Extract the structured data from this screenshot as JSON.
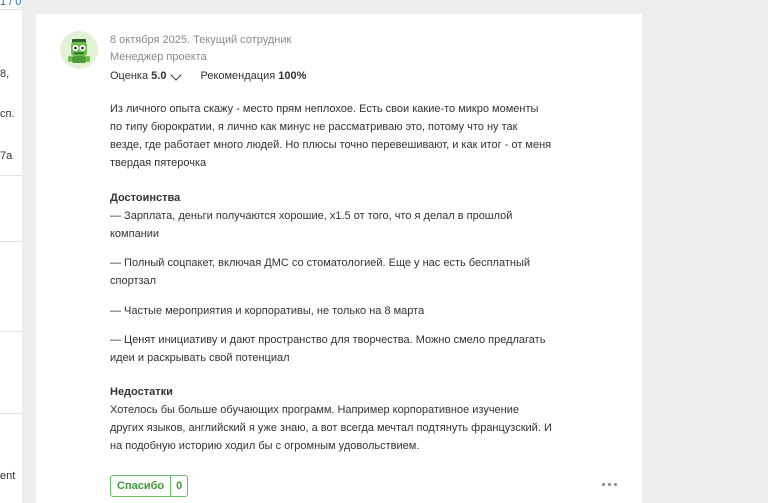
{
  "left_fragments": [
    "1 / 0",
    "8,",
    "сп.",
    "7а",
    "ent"
  ],
  "review": {
    "date_status": "8 октября 2025. Текущий сотрудник",
    "position": "Менеджер проекта",
    "rating_label": "Оценка",
    "rating_value": "5.0",
    "recommend_label": "Рекомендация",
    "recommend_value": "100%",
    "intro": [
      "Из личного опыта скажу - место прям неплохое. Есть свои какие-то микро моменты",
      "по типу бюрократии, я лично как минус не рассматриваю это, потому что ну так",
      "везде, где работает много людей. Но плюсы точно перевешивают, и как итог - от меня",
      "твердая пятерочка"
    ],
    "pros_title": "Достоинства",
    "pros": [
      [
        "— Зарплата, деньги получаются хорошие, х1.5 от того, что я делал в прошлой",
        "компании"
      ],
      [
        "— Полный соцпакет, включая ДМС со стоматологией. Еще у нас есть бесплатный",
        "спортзал"
      ],
      [
        "— Частые мероприятия и корпоративы, не только на 8 марта"
      ],
      [
        "— Ценят инициативу и дают пространство для творчества. Можно смело предлагать",
        "идеи и раскрывать свой потенциал"
      ]
    ],
    "cons_title": "Недостатки",
    "cons": [
      "Хотелось бы больше обучающих программ. Например корпоративное изучение",
      "других языков, английский я уже знаю, а вот всегда мечтал подтянуть французский. И",
      "на подобную историю ходил бы с огромным удовольствием."
    ],
    "thanks_label": "Спасибо",
    "thanks_count": "0"
  },
  "colors": {
    "accent_green": "#3b9a37",
    "link_blue": "#2d6fb6"
  },
  "icons": {
    "avatar": "robot-avatar-icon",
    "more": "more-dots-icon",
    "rating_toggle": "chevron-down-icon"
  }
}
